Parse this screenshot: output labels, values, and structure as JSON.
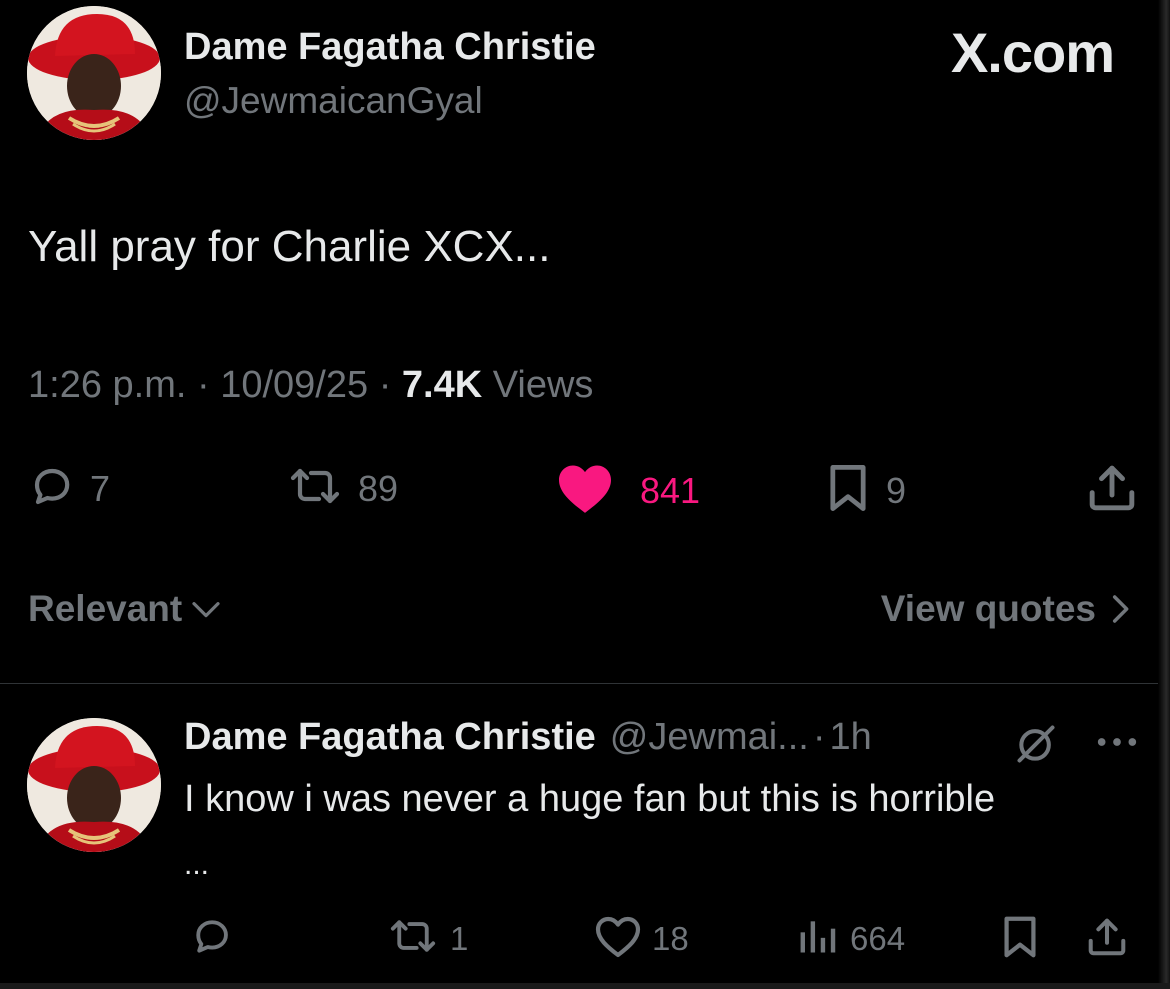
{
  "brand": "X.com",
  "tweet": {
    "author": {
      "display_name": "Dame Fagatha Christie",
      "handle": "@JewmaicanGyal"
    },
    "text": "Yall pray for Charlie XCX...",
    "time": "1:26 p.m.",
    "date": "10/09/25",
    "sep": "·",
    "views_count": "7.4K",
    "views_label": "Views",
    "actions": {
      "replies": "7",
      "reposts": "89",
      "likes": "841",
      "bookmarks": "9"
    }
  },
  "sort": {
    "label": "Relevant",
    "view_quotes": "View quotes"
  },
  "reply": {
    "display_name": "Dame Fagatha Christie",
    "handle": "@Jewmai...",
    "sep": "·",
    "time": "1h",
    "text": "I know i was never a huge fan but this is horrible",
    "ellipsis": "...",
    "more": "···",
    "actions": {
      "replies": "",
      "reposts": "1",
      "likes": "18",
      "views": "664"
    }
  },
  "colors": {
    "background": "#000000",
    "text": "#e7e9ea",
    "muted": "#71767b",
    "like": "#f91880",
    "divider": "#2f3336"
  }
}
